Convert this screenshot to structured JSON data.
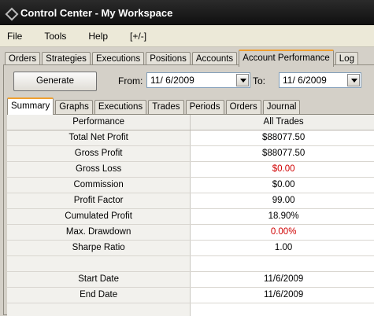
{
  "window": {
    "title": "Control Center - My Workspace"
  },
  "menu": [
    "File",
    "Tools",
    "Help",
    "[+/-]"
  ],
  "main_tabs": [
    "Orders",
    "Strategies",
    "Executions",
    "Positions",
    "Accounts",
    "Account Performance",
    "Log"
  ],
  "main_tab_active": "Account Performance",
  "toolbar": {
    "generate_label": "Generate",
    "from_label": "From:",
    "from_value": "11/ 6/2009",
    "to_label": "To:",
    "to_value": "11/ 6/2009"
  },
  "sub_tabs": [
    "Summary",
    "Graphs",
    "Executions",
    "Trades",
    "Periods",
    "Orders",
    "Journal"
  ],
  "sub_tab_active": "Summary",
  "colors": {
    "negative": "#d00000",
    "active_tab_accent": "#f0a030",
    "titlebar": "#1a1a1a"
  },
  "table": {
    "columns": [
      "Performance",
      "All Trades"
    ],
    "rows": [
      [
        "Total Net Profit",
        "$88077.50"
      ],
      [
        "Gross Profit",
        "$88077.50"
      ],
      [
        "Gross Loss",
        "$0.00"
      ],
      [
        "Commission",
        "$0.00"
      ],
      [
        "Profit Factor",
        "99.00"
      ],
      [
        "Cumulated Profit",
        "18.90%"
      ],
      [
        "Max. Drawdown",
        "0.00%"
      ],
      [
        "Sharpe Ratio",
        "1.00"
      ],
      [
        "",
        ""
      ],
      [
        "Start Date",
        "11/6/2009"
      ],
      [
        "End Date",
        "11/6/2009"
      ]
    ]
  }
}
